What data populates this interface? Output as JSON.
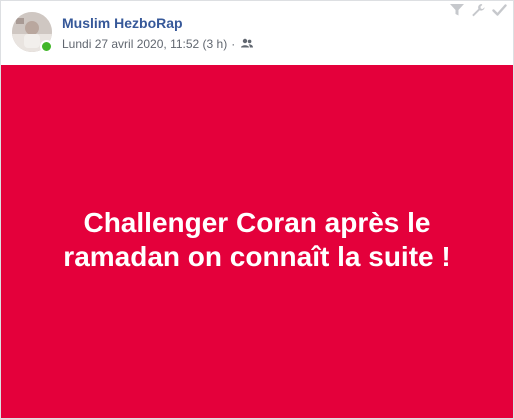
{
  "post": {
    "author": "Muslim HezboRap",
    "timestamp": "Lundi 27 avril 2020, 11:52 (3 h)",
    "separator": "·",
    "audience_icon": "friends-icon",
    "online_status_color": "#42b72a",
    "author_color": "#365899",
    "background_color": "#e4003b",
    "text": "Challenger Coran après le ramadan on connaît la suite !",
    "toolbar_icons": [
      "filter-icon",
      "wrench-icon",
      "check-icon"
    ]
  }
}
